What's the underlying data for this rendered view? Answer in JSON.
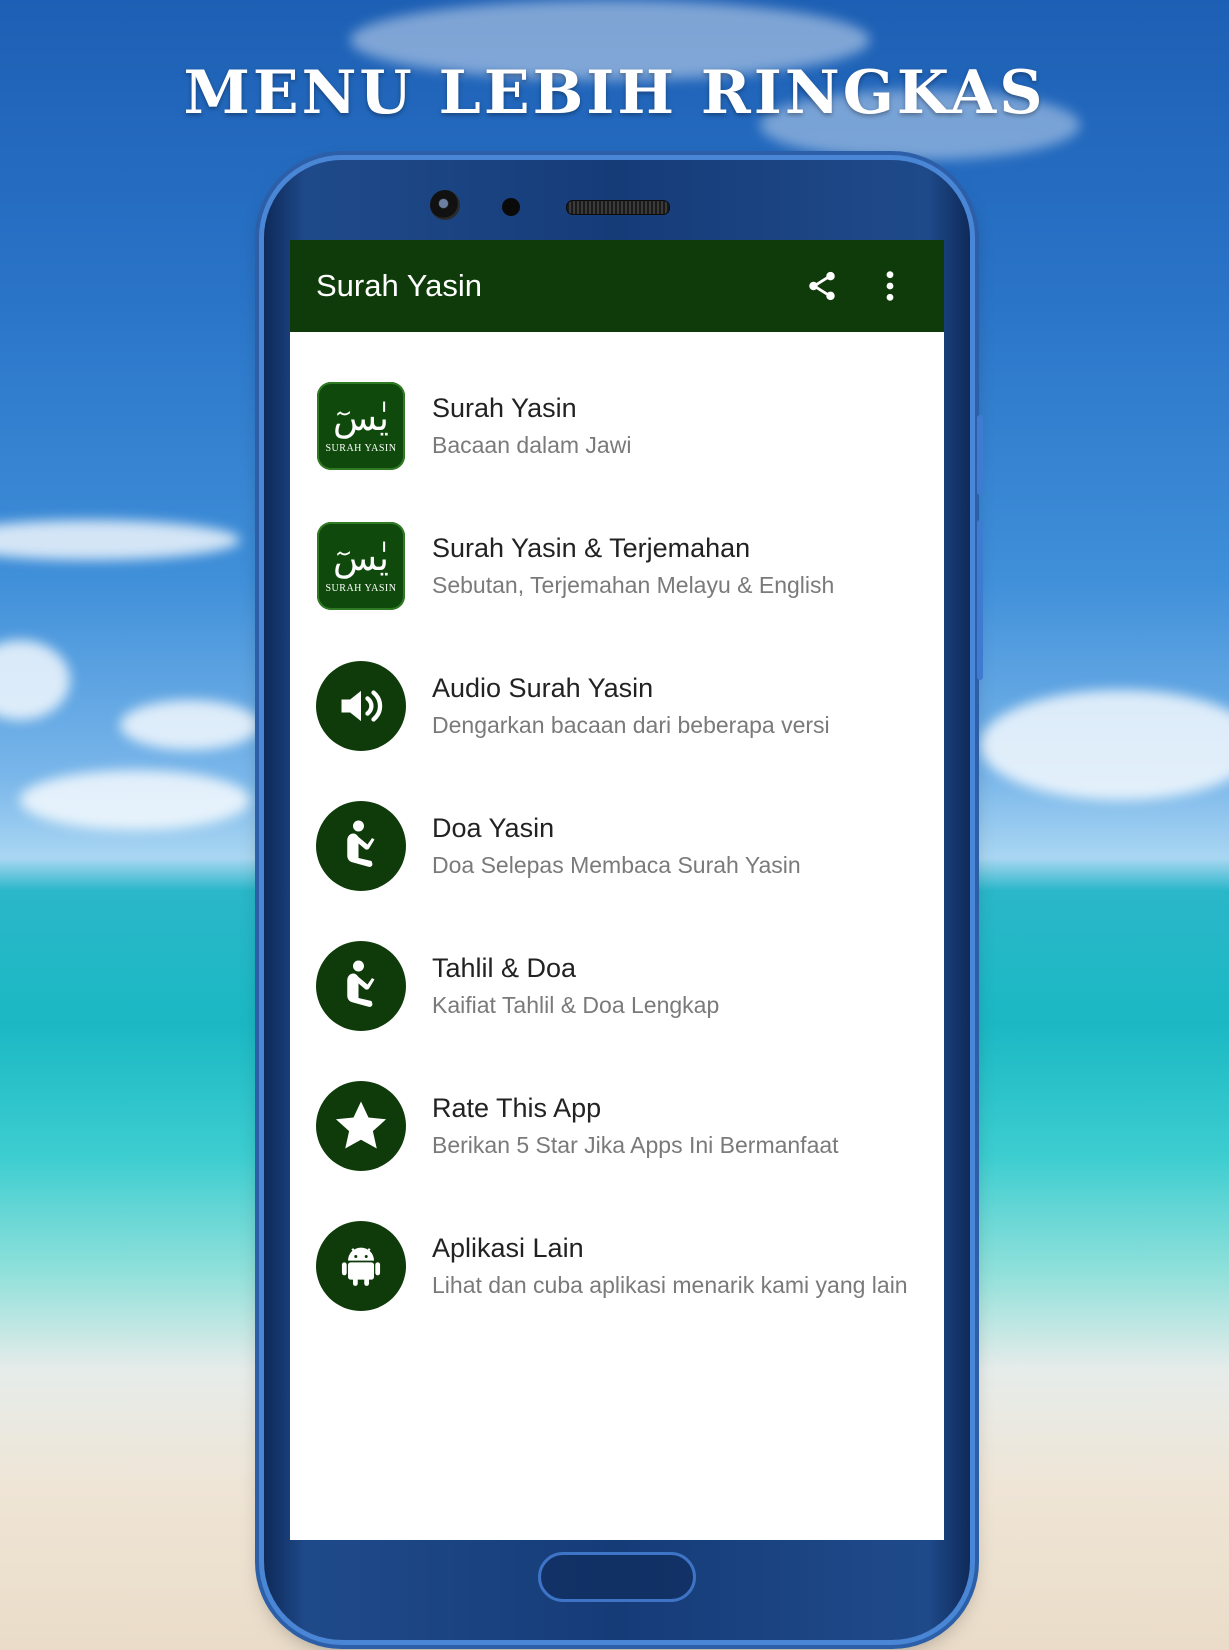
{
  "promo": {
    "headline": "MENU LEBIH RINGKAS"
  },
  "appbar": {
    "title": "Surah Yasin",
    "share_icon": "share-icon",
    "overflow_icon": "more-vert-icon"
  },
  "colors": {
    "appbar": "#0f3a0a",
    "icon_bg": "#0f3a0a",
    "primary_text": "#222222",
    "secondary_text": "#7a7a7a"
  },
  "menu": {
    "items": [
      {
        "title": "Surah Yasin",
        "subtitle": "Bacaan dalam Jawi",
        "icon": "yasin-tile-icon",
        "tile_arabic": "يٰسٓ",
        "tile_label": "SURAH YASIN"
      },
      {
        "title": "Surah Yasin & Terjemahan",
        "subtitle": "Sebutan, Terjemahan Melayu & English",
        "icon": "yasin-tile-icon",
        "tile_arabic": "يٰسٓ",
        "tile_label": "SURAH YASIN"
      },
      {
        "title": "Audio Surah Yasin",
        "subtitle": "Dengarkan bacaan dari beberapa versi",
        "icon": "speaker-icon"
      },
      {
        "title": "Doa Yasin",
        "subtitle": "Doa Selepas Membaca Surah Yasin",
        "icon": "praying-person-icon"
      },
      {
        "title": "Tahlil & Doa",
        "subtitle": "Kaifiat Tahlil & Doa Lengkap",
        "icon": "praying-person-icon"
      },
      {
        "title": "Rate This App",
        "subtitle": "Berikan 5 Star Jika Apps Ini Bermanfaat",
        "icon": "star-icon"
      },
      {
        "title": "Aplikasi Lain",
        "subtitle": "Lihat dan cuba aplikasi menarik kami yang lain",
        "icon": "android-icon"
      }
    ]
  }
}
